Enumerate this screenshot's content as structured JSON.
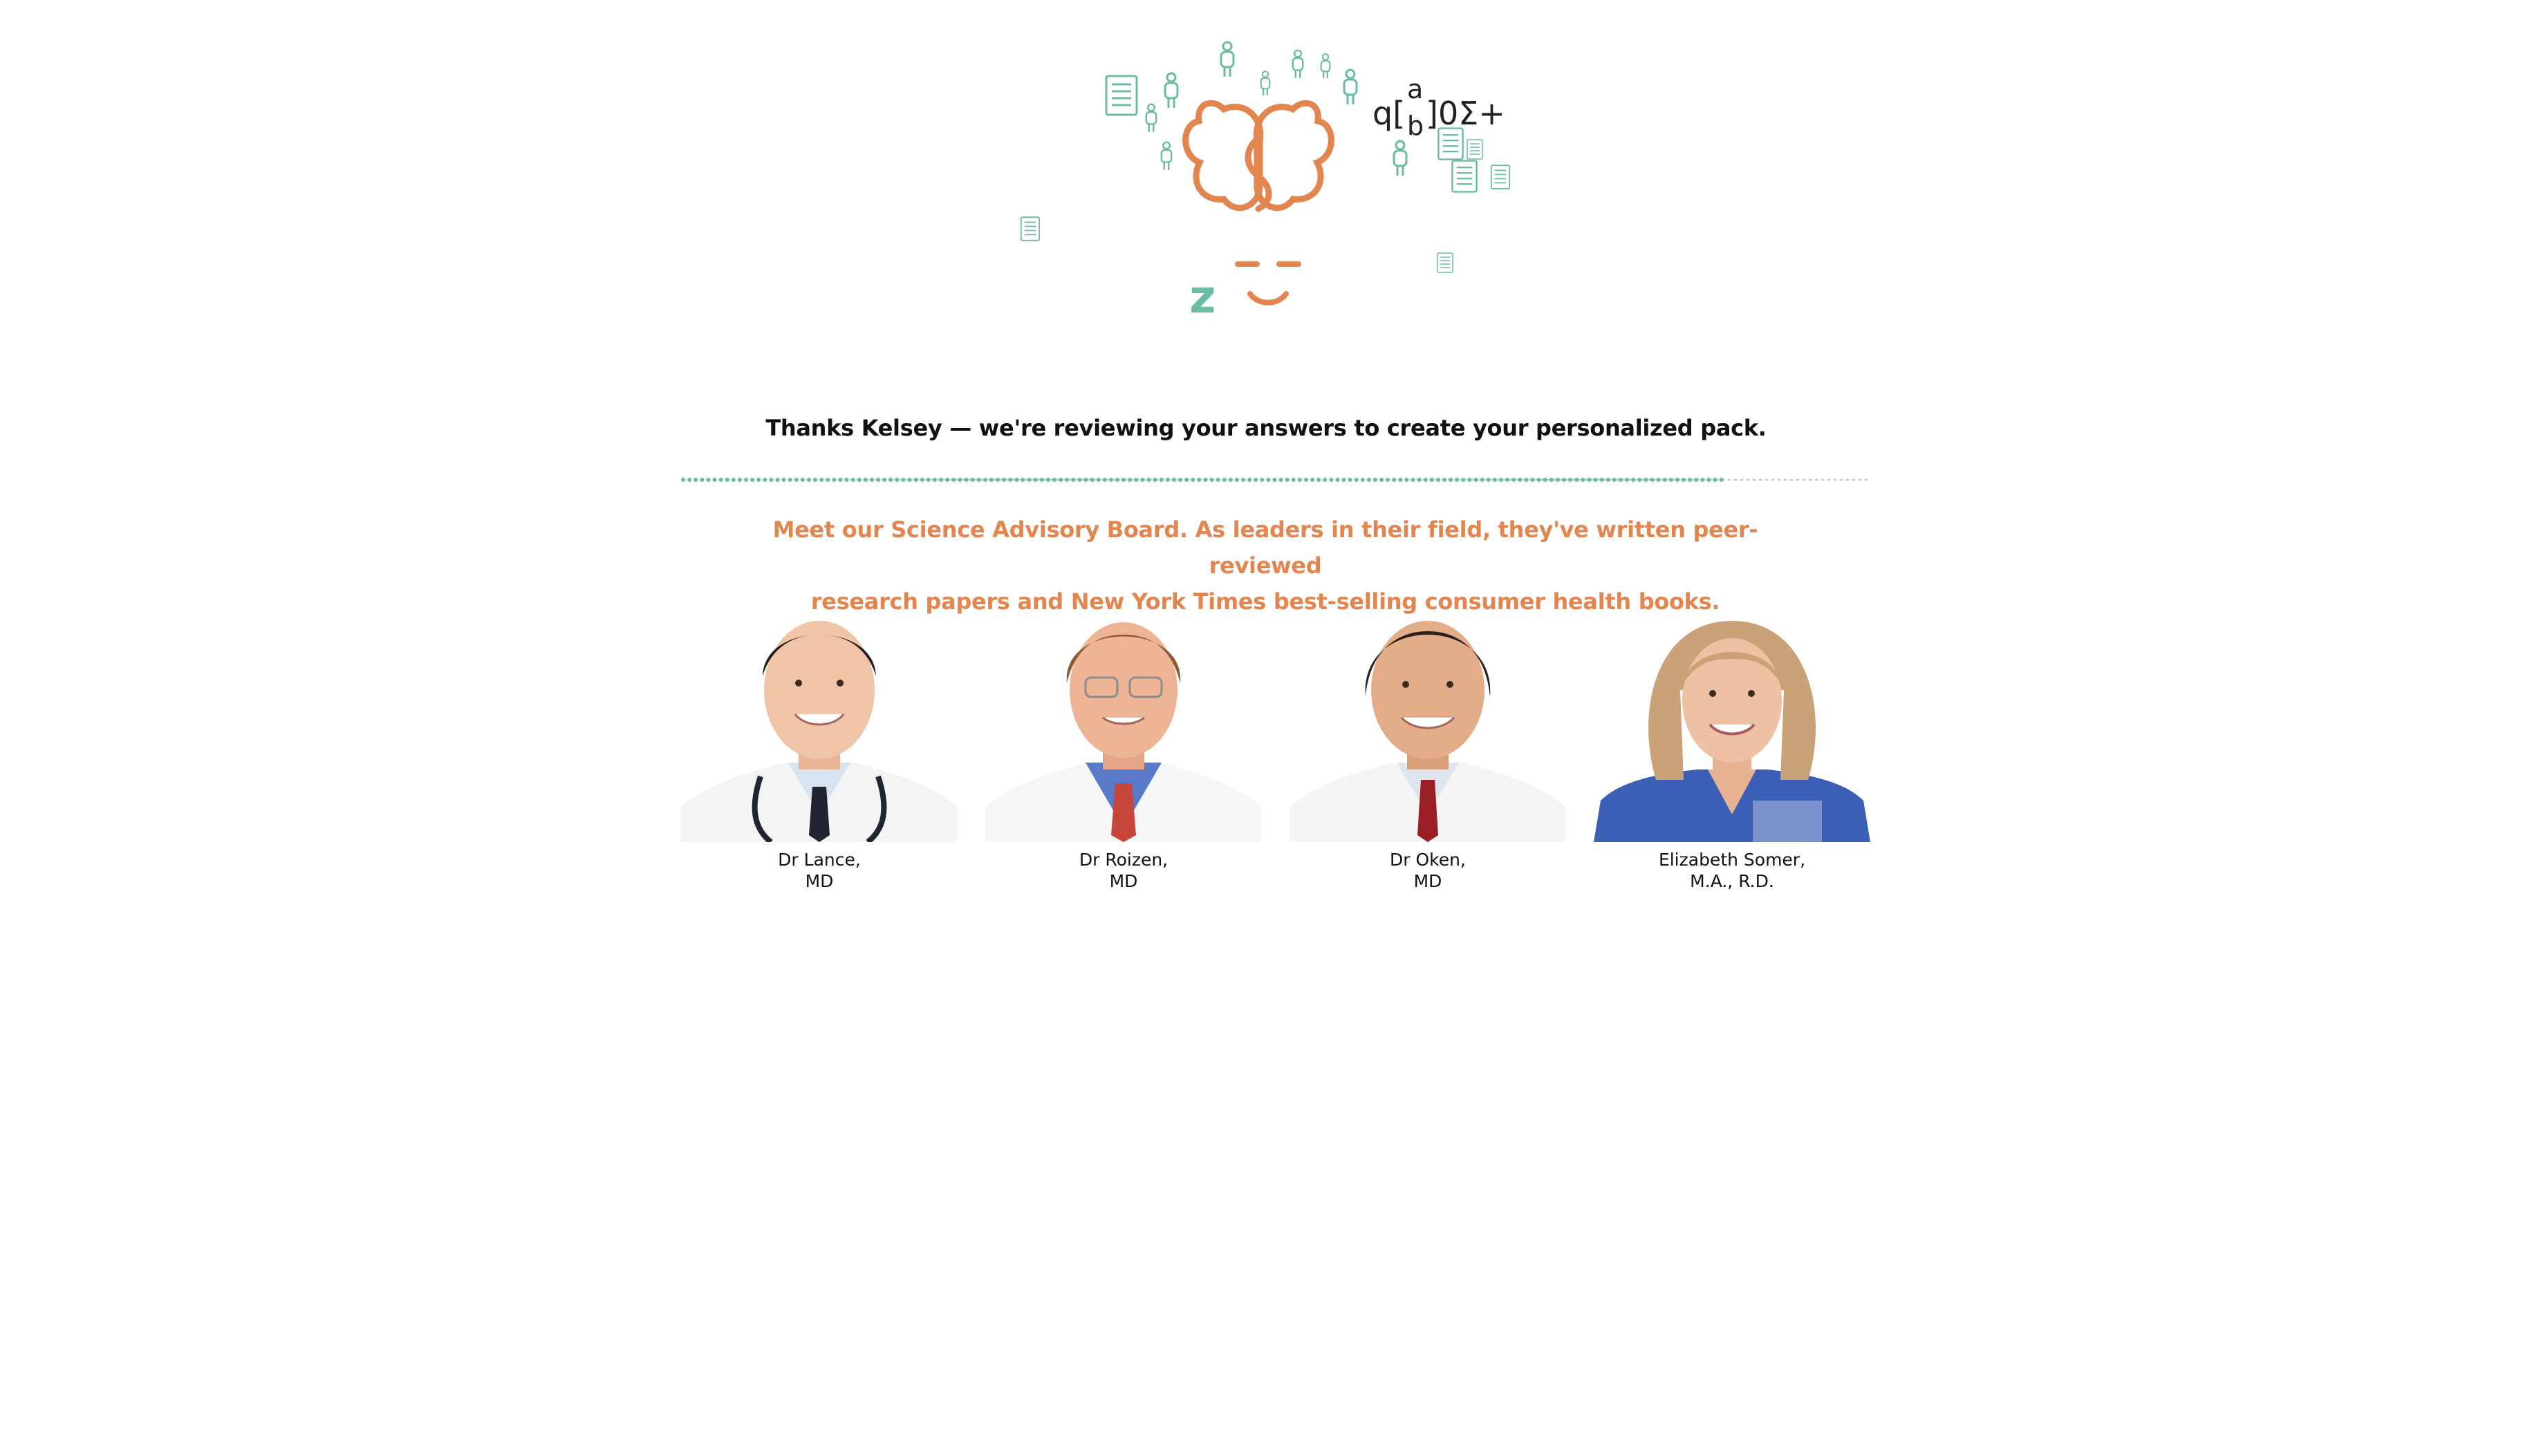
{
  "colors": {
    "accent_orange": "#E2854E",
    "accent_teal": "#6BBBA5",
    "text_dark": "#111111",
    "track_grey": "#C9CED0"
  },
  "logo": {
    "icon": "brain-face-logo-icon",
    "sleep_letter": "z",
    "formula": {
      "prefix": "q[",
      "top": "a",
      "bottom": "b",
      "suffix": "]0Σ+"
    }
  },
  "status": {
    "headline": "Thanks Kelsey — we're reviewing your answers to create your personalized pack.",
    "progress": 0.88
  },
  "board": {
    "intro_line1": "Meet our Science Advisory Board. As leaders in their field, they've written peer-reviewed",
    "intro_line2": "research papers and New York Times best-selling consumer health books.",
    "members": [
      {
        "name": "Dr Lance,",
        "credentials": "MD"
      },
      {
        "name": "Dr Roizen,",
        "credentials": "MD"
      },
      {
        "name": "Dr Oken,",
        "credentials": "MD"
      },
      {
        "name": "Elizabeth Somer,",
        "credentials": "M.A., R.D."
      }
    ]
  }
}
